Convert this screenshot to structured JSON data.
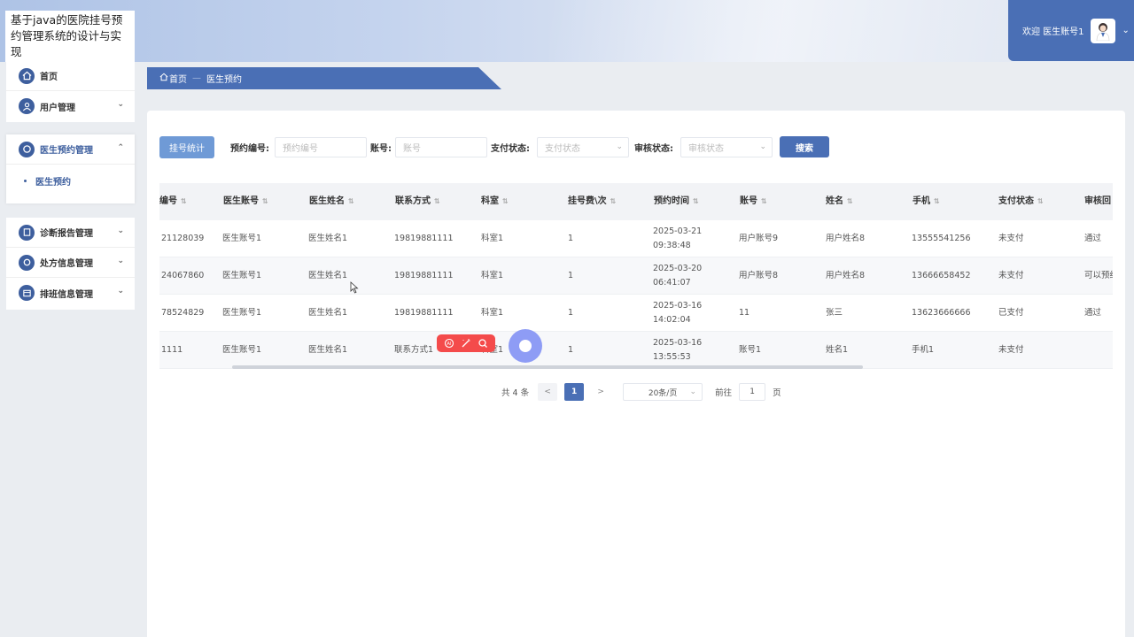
{
  "app": {
    "title": "基于java的医院挂号预约管理系统的设计与实现",
    "welcome": "欢迎 医生账号1"
  },
  "sidebar": {
    "home": "首页",
    "user_mgmt": "用户管理",
    "doctor_appt_mgmt": "医生预约管理",
    "doctor_appt": "医生预约",
    "diag_report_mgmt": "诊断报告管理",
    "prescription_mgmt": "处方信息管理",
    "schedule_mgmt": "排班信息管理"
  },
  "breadcrumb": {
    "home": "首页",
    "current": "医生预约"
  },
  "toolbar": {
    "stat_button": "挂号统计",
    "appt_no_label": "预约编号:",
    "appt_no_placeholder": "预约编号",
    "account_label": "账号:",
    "account_placeholder": "账号",
    "pay_status_label": "支付状态:",
    "pay_status_placeholder": "支付状态",
    "review_status_label": "审核状态:",
    "review_status_placeholder": "审核状态",
    "search_button": "搜索"
  },
  "table": {
    "columns": [
      "编号",
      "医生账号",
      "医生姓名",
      "联系方式",
      "科室",
      "挂号费\\次",
      "预约时间",
      "账号",
      "姓名",
      "手机",
      "支付状态",
      "审核回"
    ],
    "rows": [
      [
        "21128039",
        "医生账号1",
        "医生姓名1",
        "19819881111",
        "科室1",
        "1",
        "2025-03-21 09:38:48",
        "用户账号9",
        "用户姓名8",
        "13555541256",
        "未支付",
        "通过"
      ],
      [
        "24067860",
        "医生账号1",
        "医生姓名1",
        "19819881111",
        "科室1",
        "1",
        "2025-03-20 06:41:07",
        "用户账号8",
        "用户姓名8",
        "13666658452",
        "未支付",
        "可以预约"
      ],
      [
        "78524829",
        "医生账号1",
        "医生姓名1",
        "19819881111",
        "科室1",
        "1",
        "2025-03-16 14:02:04",
        "11",
        "张三",
        "13623666666",
        "已支付",
        "通过"
      ],
      [
        "1111",
        "医生账号1",
        "医生姓名1",
        "联系方式1",
        "科室1",
        "1",
        "2025-03-16 13:55:53",
        "账号1",
        "姓名1",
        "手机1",
        "未支付",
        ""
      ]
    ]
  },
  "pagination": {
    "total": "共 4 条",
    "prev": "<",
    "current": "1",
    "next": ">",
    "page_size": "20条/页",
    "goto_label": "前往",
    "goto_value": "1",
    "page_unit": "页"
  },
  "colors": {
    "primary": "#4a6fb5",
    "stat_button": "#6f9ad6",
    "float_bar": "#f44b4b",
    "float_ball": "#8e9cf5"
  }
}
